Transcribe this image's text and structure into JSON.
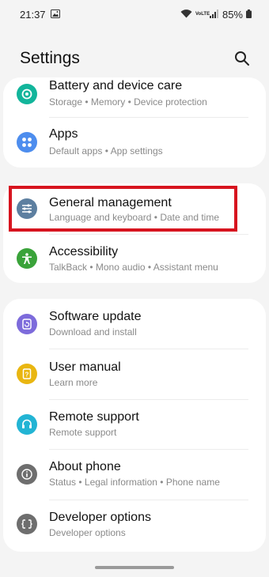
{
  "status": {
    "time": "21:37",
    "battery": "85%",
    "network": "VoLTE"
  },
  "header": {
    "title": "Settings"
  },
  "group1": [
    {
      "title": "Battery and device care",
      "subtitle": "Storage  •  Memory  •  Device protection",
      "icon": "battery-care-icon",
      "color": "#12b59b"
    },
    {
      "title": "Apps",
      "subtitle": "Default apps  •  App settings",
      "icon": "apps-icon",
      "color": "#4d8dee"
    }
  ],
  "group2": [
    {
      "title": "General management",
      "subtitle": "Language and keyboard  •  Date and time",
      "icon": "general-management-icon",
      "color": "#5d7fa0"
    },
    {
      "title": "Accessibility",
      "subtitle": "TalkBack  •  Mono audio  •  Assistant menu",
      "icon": "accessibility-icon",
      "color": "#3aa33a"
    }
  ],
  "group3": [
    {
      "title": "Software update",
      "subtitle": "Download and install",
      "icon": "software-update-icon",
      "color": "#7d6bdb"
    },
    {
      "title": "User manual",
      "subtitle": "Learn more",
      "icon": "user-manual-icon",
      "color": "#e9b611"
    },
    {
      "title": "Remote support",
      "subtitle": "Remote support",
      "icon": "remote-support-icon",
      "color": "#22b4d4"
    },
    {
      "title": "About phone",
      "subtitle": "Status  •  Legal information  •  Phone name",
      "icon": "about-phone-icon",
      "color": "#6e6e6e"
    },
    {
      "title": "Developer options",
      "subtitle": "Developer options",
      "icon": "developer-options-icon",
      "color": "#6e6e6e"
    }
  ]
}
